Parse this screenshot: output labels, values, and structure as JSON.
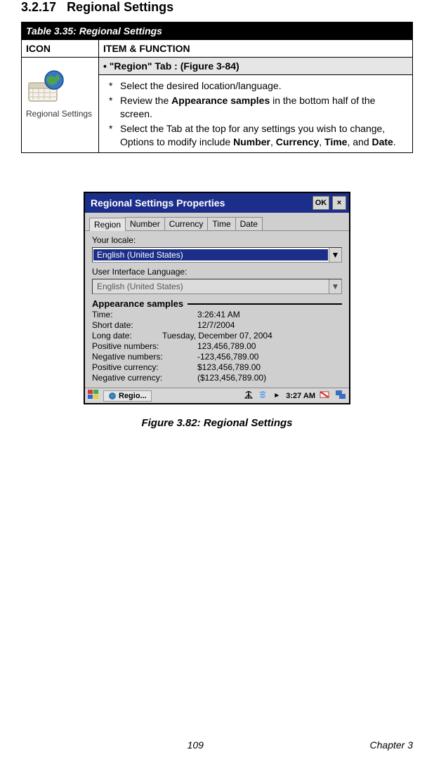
{
  "section": {
    "number": "3.2.17",
    "title": "Regional Settings"
  },
  "table": {
    "caption": "Table 3.35: Regional Settings",
    "col_icon": "ICON",
    "col_item": "ITEM & FUNCTION",
    "region_tab": "•  \"Region\" Tab : (Figure 3-84)",
    "icon_label": "Regional Settings",
    "bullets": {
      "b1": "Select the desired location/language.",
      "b2a": "Review the ",
      "b2b": "Appearance samples",
      "b2c": " in the bottom half of the screen.",
      "b3a": "Select the Tab at the top for any settings you wish to change, Options to modify include ",
      "b3b": "Number",
      "b3c": ", ",
      "b3d": "Currency",
      "b3e": ", ",
      "b3f": "Time",
      "b3g": ", and ",
      "b3h": "Date",
      "b3i": "."
    }
  },
  "win": {
    "title": "Regional Settings Properties",
    "ok": "OK",
    "close": "×",
    "tabs": {
      "t1": "Region",
      "t2": "Number",
      "t3": "Currency",
      "t4": "Time",
      "t5": "Date"
    },
    "locale_label": "Your locale:",
    "locale_value": "English (United States)",
    "uilang_label": "User Interface Language:",
    "uilang_value": "English (United States)",
    "arrow": "▼",
    "appearance": "Appearance samples",
    "samples": {
      "time_k": "Time:",
      "time_v": "3:26:41 AM",
      "sdate_k": "Short date:",
      "sdate_v": "12/7/2004",
      "ldate_k": "Long date:",
      "ldate_v": "Tuesday, December 07, 2004",
      "pnum_k": "Positive numbers:",
      "pnum_v": "123,456,789.00",
      "nnum_k": "Negative numbers:",
      "nnum_v": "-123,456,789.00",
      "pcur_k": "Positive currency:",
      "pcur_v": "$123,456,789.00",
      "ncur_k": "Negative currency:",
      "ncur_v": "($123,456,789.00)"
    },
    "taskbar": {
      "app": "Regio...",
      "clock": "3:27 AM",
      "arrow": "►"
    }
  },
  "figure_caption": "Figure 3.82: Regional Settings",
  "footer": {
    "page": "109",
    "chapter": "Chapter 3"
  }
}
